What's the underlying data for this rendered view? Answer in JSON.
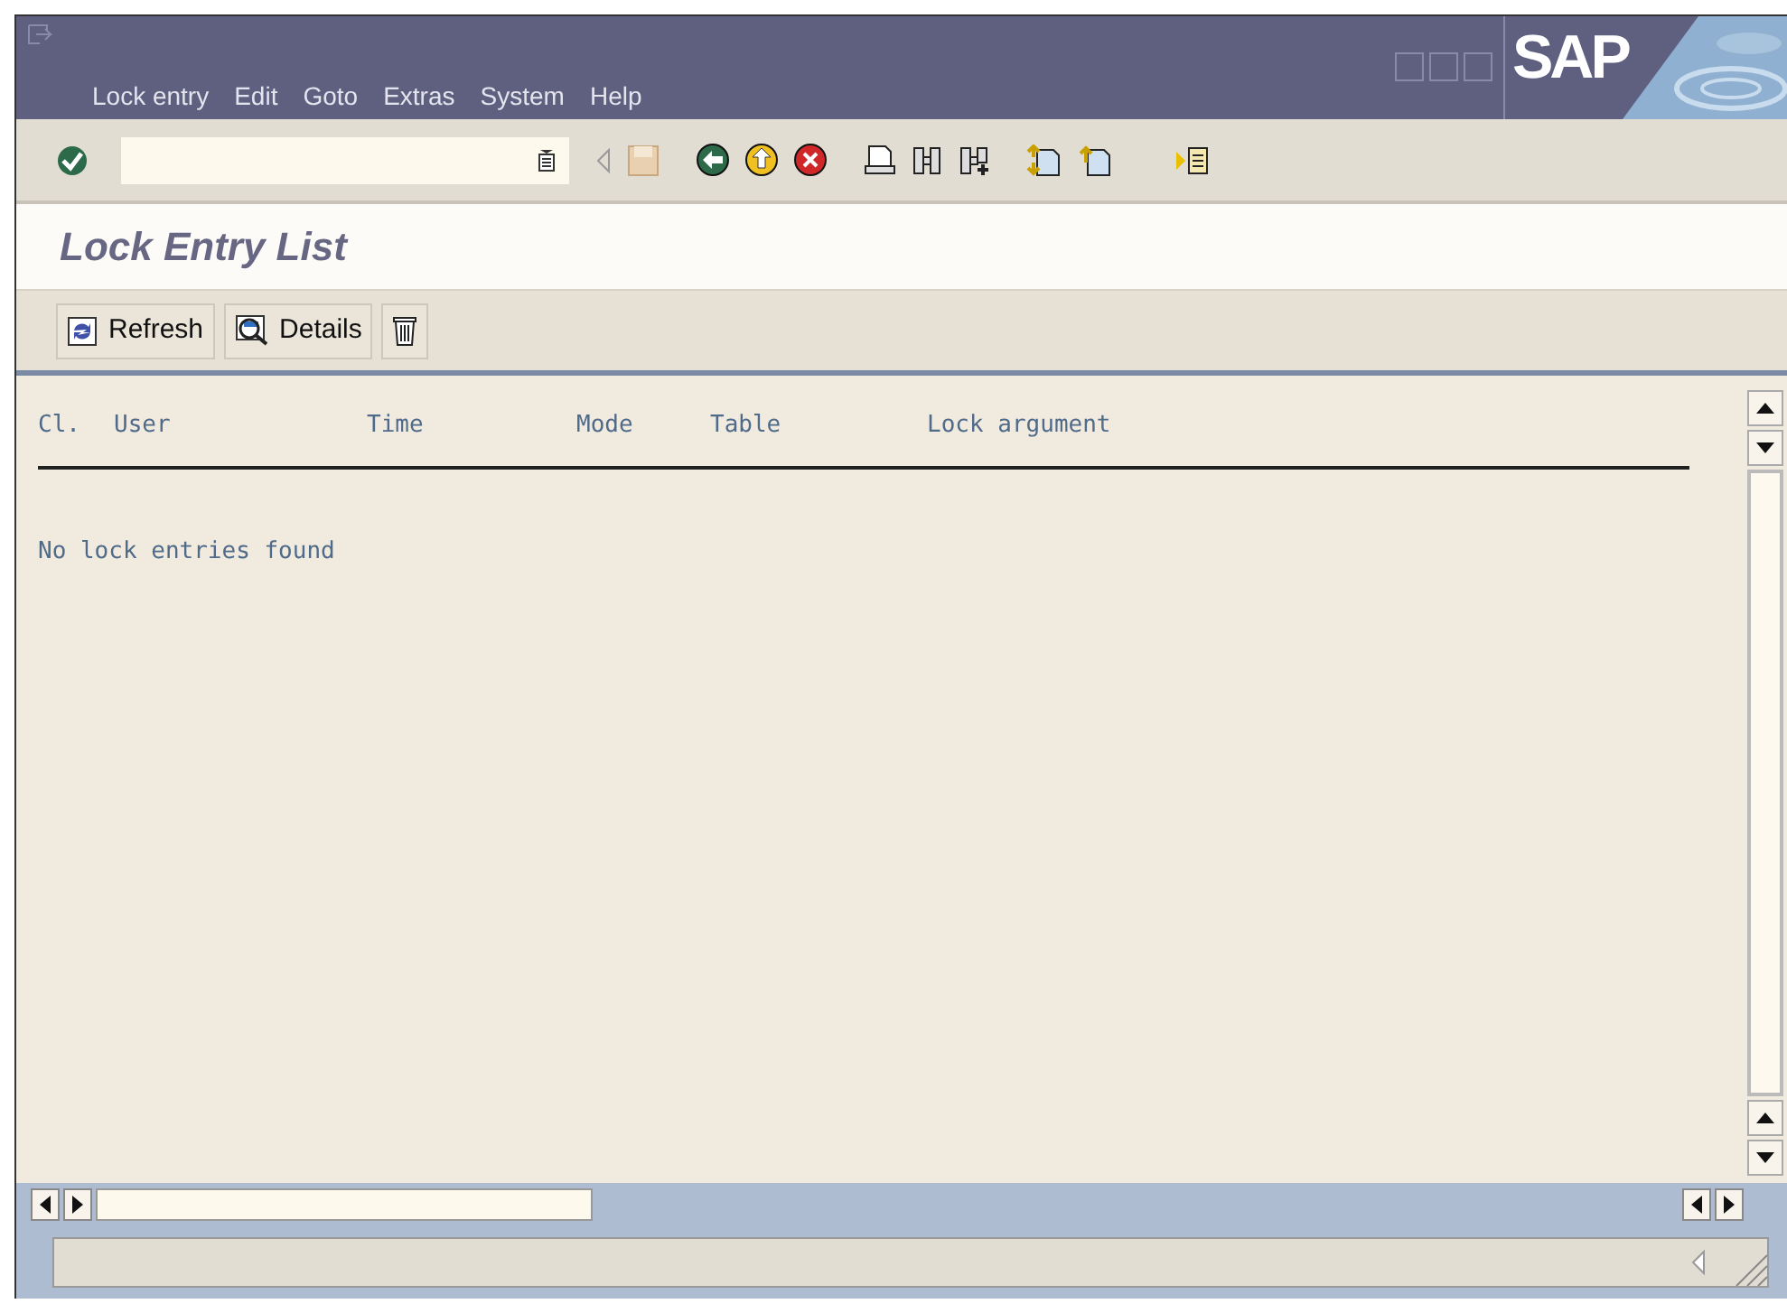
{
  "menu": [
    "Lock entry",
    "Edit",
    "Goto",
    "Extras",
    "System",
    "Help"
  ],
  "logo": "SAP",
  "title": "Lock Entry List",
  "app_toolbar": [
    {
      "kind": "refresh",
      "label": "Refresh"
    },
    {
      "kind": "details",
      "label": "Details"
    },
    {
      "kind": "delete"
    }
  ],
  "columns": [
    "Cl.",
    "User",
    "Time",
    "Mode",
    "Table",
    "Lock argument"
  ],
  "message": "No lock entries found"
}
